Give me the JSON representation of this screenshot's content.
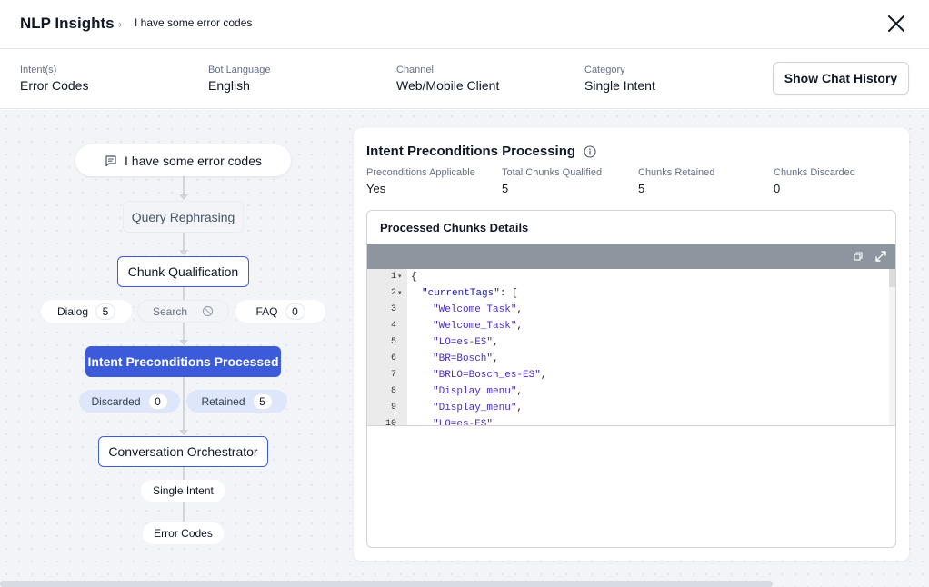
{
  "header": {
    "title": "NLP Insights",
    "breadcrumb": "I have some error codes"
  },
  "meta": {
    "intent_label": "Intent(s)",
    "intent_value": "Error Codes",
    "language_label": "Bot Language",
    "language_value": "English",
    "channel_label": "Channel",
    "channel_value": "Web/Mobile Client",
    "category_label": "Category",
    "category_value": "Single Intent",
    "history_button": "Show Chat History"
  },
  "flow": {
    "query": "I have some error codes",
    "rephrasing": "Query Rephrasing",
    "chunk_qualification": "Chunk Qualification",
    "dialog_label": "Dialog",
    "dialog_count": "5",
    "search_label": "Search",
    "faq_label": "FAQ",
    "faq_count": "0",
    "intent_preconditions": "Intent Preconditions Processed",
    "discarded_label": "Discarded",
    "discarded_count": "0",
    "retained_label": "Retained",
    "retained_count": "5",
    "orchestrator": "Conversation Orchestrator",
    "single_intent": "Single Intent",
    "result": "Error Codes"
  },
  "panel": {
    "title": "Intent Preconditions Processing",
    "applicable_label": "Preconditions Applicable",
    "applicable_value": "Yes",
    "qualified_label": "Total Chunks Qualified",
    "qualified_value": "5",
    "retained_label": "Chunks Retained",
    "retained_value": "5",
    "discarded_label": "Chunks Discarded",
    "discarded_value": "0",
    "chunks_title": "Processed Chunks Details"
  },
  "code_lines": [
    {
      "n": "1",
      "fold": true,
      "text": "{"
    },
    {
      "n": "2",
      "fold": true,
      "key": "\"currentTags\"",
      "text": ": ["
    },
    {
      "n": "3",
      "str": "\"Welcome Task\"",
      "text": ","
    },
    {
      "n": "4",
      "str": "\"Welcome_Task\"",
      "text": ","
    },
    {
      "n": "5",
      "str": "\"LO=es-ES\"",
      "text": ","
    },
    {
      "n": "6",
      "str": "\"BR=Bosch\"",
      "text": ","
    },
    {
      "n": "7",
      "str": "\"BRLO=Bosch_es-ES\"",
      "text": ","
    },
    {
      "n": "8",
      "str": "\"Display menu\"",
      "text": ","
    },
    {
      "n": "9",
      "str": "\"Display_menu\"",
      "text": ","
    },
    {
      "n": "10",
      "str": "\"LO=es-ES\"",
      "text": ""
    }
  ],
  "colors": {
    "accent": "#3b5bdb",
    "pill_blue": "#dde6fb",
    "toolbar": "#8d959e"
  },
  "icons": {
    "close": "close-icon",
    "chat": "chat-bubble-icon",
    "info": "info-icon",
    "ban": "ban-icon",
    "restore": "restore-window-icon",
    "expand": "expand-icon"
  }
}
